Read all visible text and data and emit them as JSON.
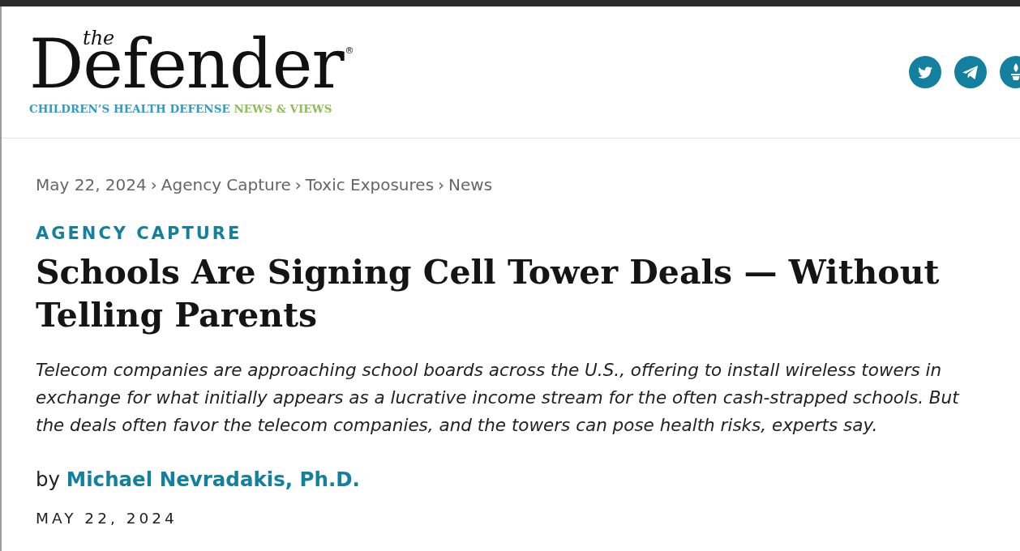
{
  "header": {
    "logo": {
      "small_text": "the",
      "wordmark": "Defender",
      "registered_mark": "®"
    },
    "tagline": [
      "CHILDREN’S HEALTH DEFENSE",
      "NEWS & VIEWS"
    ]
  },
  "article": {
    "breadcrumb": {
      "items": [
        "May 22, 2024",
        "Agency Capture",
        "Toxic Exposures",
        "News"
      ],
      "separators": [
        "›",
        "›",
        "›"
      ]
    },
    "category": "AGENCY CAPTURE",
    "title": "Schools Are Signing Cell Tower Deals — Without Telling Parents",
    "subtitle": "Telecom companies are approaching school boards across the U.S., offering to install wireless towers in exchange for what initially appears as a lucrative income stream for the often cash-strapped schools. But the deals often favor the telecom companies, and the towers can pose health risks, experts say.",
    "byline": {
      "prefix": "by",
      "author": "Michael Nevradakis, Ph.D."
    },
    "date": "MAY 22, 2024"
  }
}
